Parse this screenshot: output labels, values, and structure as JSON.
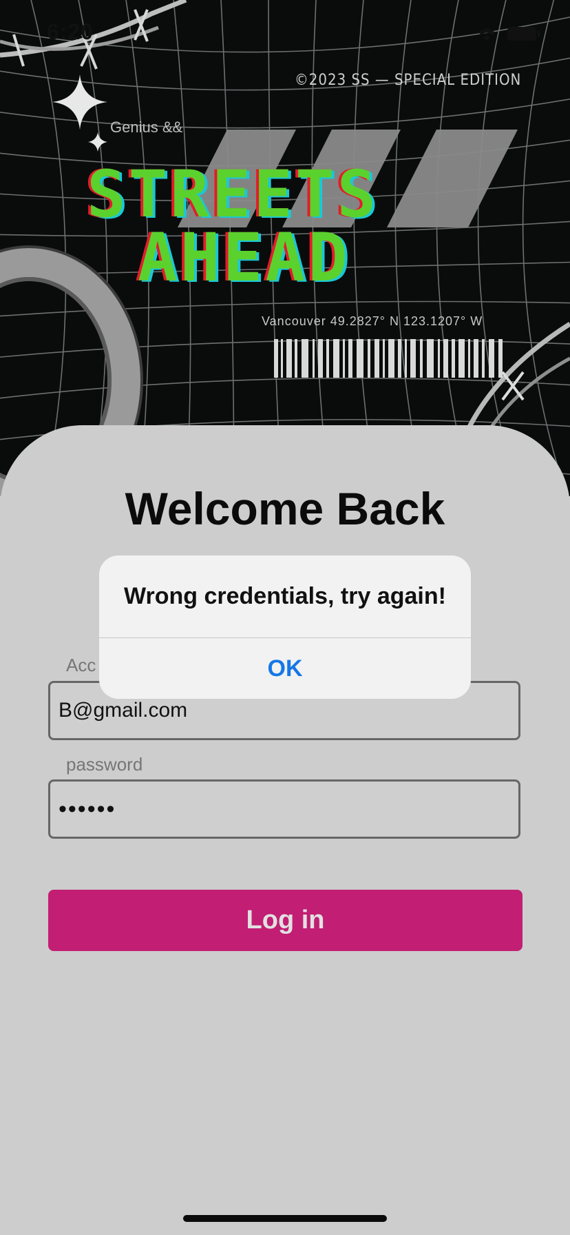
{
  "status_bar": {
    "time": "6:20",
    "icons": [
      "wifi-icon",
      "battery-icon"
    ]
  },
  "banner": {
    "edition": "©2023 SS — SPECIAL EDITION",
    "tagline": "Genius &&",
    "title_line1": "STReeTS",
    "title_line2": "AHeaD",
    "coordinates": "Vancouver 49.2827° N 123.1207° W",
    "colors": {
      "title": "#5bd12e",
      "title_shadow_red": "#e51b2b",
      "title_shadow_cyan": "#19c8d8",
      "background": "#0a0c0c"
    }
  },
  "login": {
    "heading": "Welcome Back",
    "account_label": "Acc",
    "account_value": "B@gmail.com",
    "password_label": "password",
    "password_value": "••••••",
    "login_button": "Log in",
    "button_color": "#c21e73"
  },
  "alert": {
    "message": "Wrong credentials, try again!",
    "ok_label": "OK",
    "ok_color": "#1677e6"
  }
}
